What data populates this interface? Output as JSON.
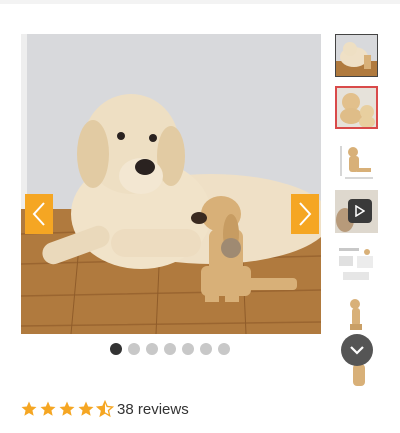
{
  "gallery": {
    "main_image": {
      "description_icon": "golden-retriever-photo"
    },
    "prev_icon": "chevron-left-icon",
    "next_icon": "chevron-right-icon",
    "dots_total": 7,
    "active_dot": 1,
    "thumbnails": [
      {
        "name": "thumb-dog-photo",
        "selected": true
      },
      {
        "name": "thumb-two-dogs",
        "highlighted": true
      },
      {
        "name": "thumb-dimensions-diagram"
      },
      {
        "name": "thumb-video",
        "icon": "play-icon"
      },
      {
        "name": "thumb-instructions"
      },
      {
        "name": "thumb-block-dog-side"
      },
      {
        "name": "thumb-block-dog-partial"
      }
    ],
    "scroll_icon": "chevron-down-icon"
  },
  "rating": {
    "stars_value": 4.5,
    "stars_max": 5,
    "reviews_label": "38 reviews",
    "star_color": "#f5a623"
  },
  "colors": {
    "accent": "#f5a623",
    "highlight_border": "#d94a4a"
  }
}
